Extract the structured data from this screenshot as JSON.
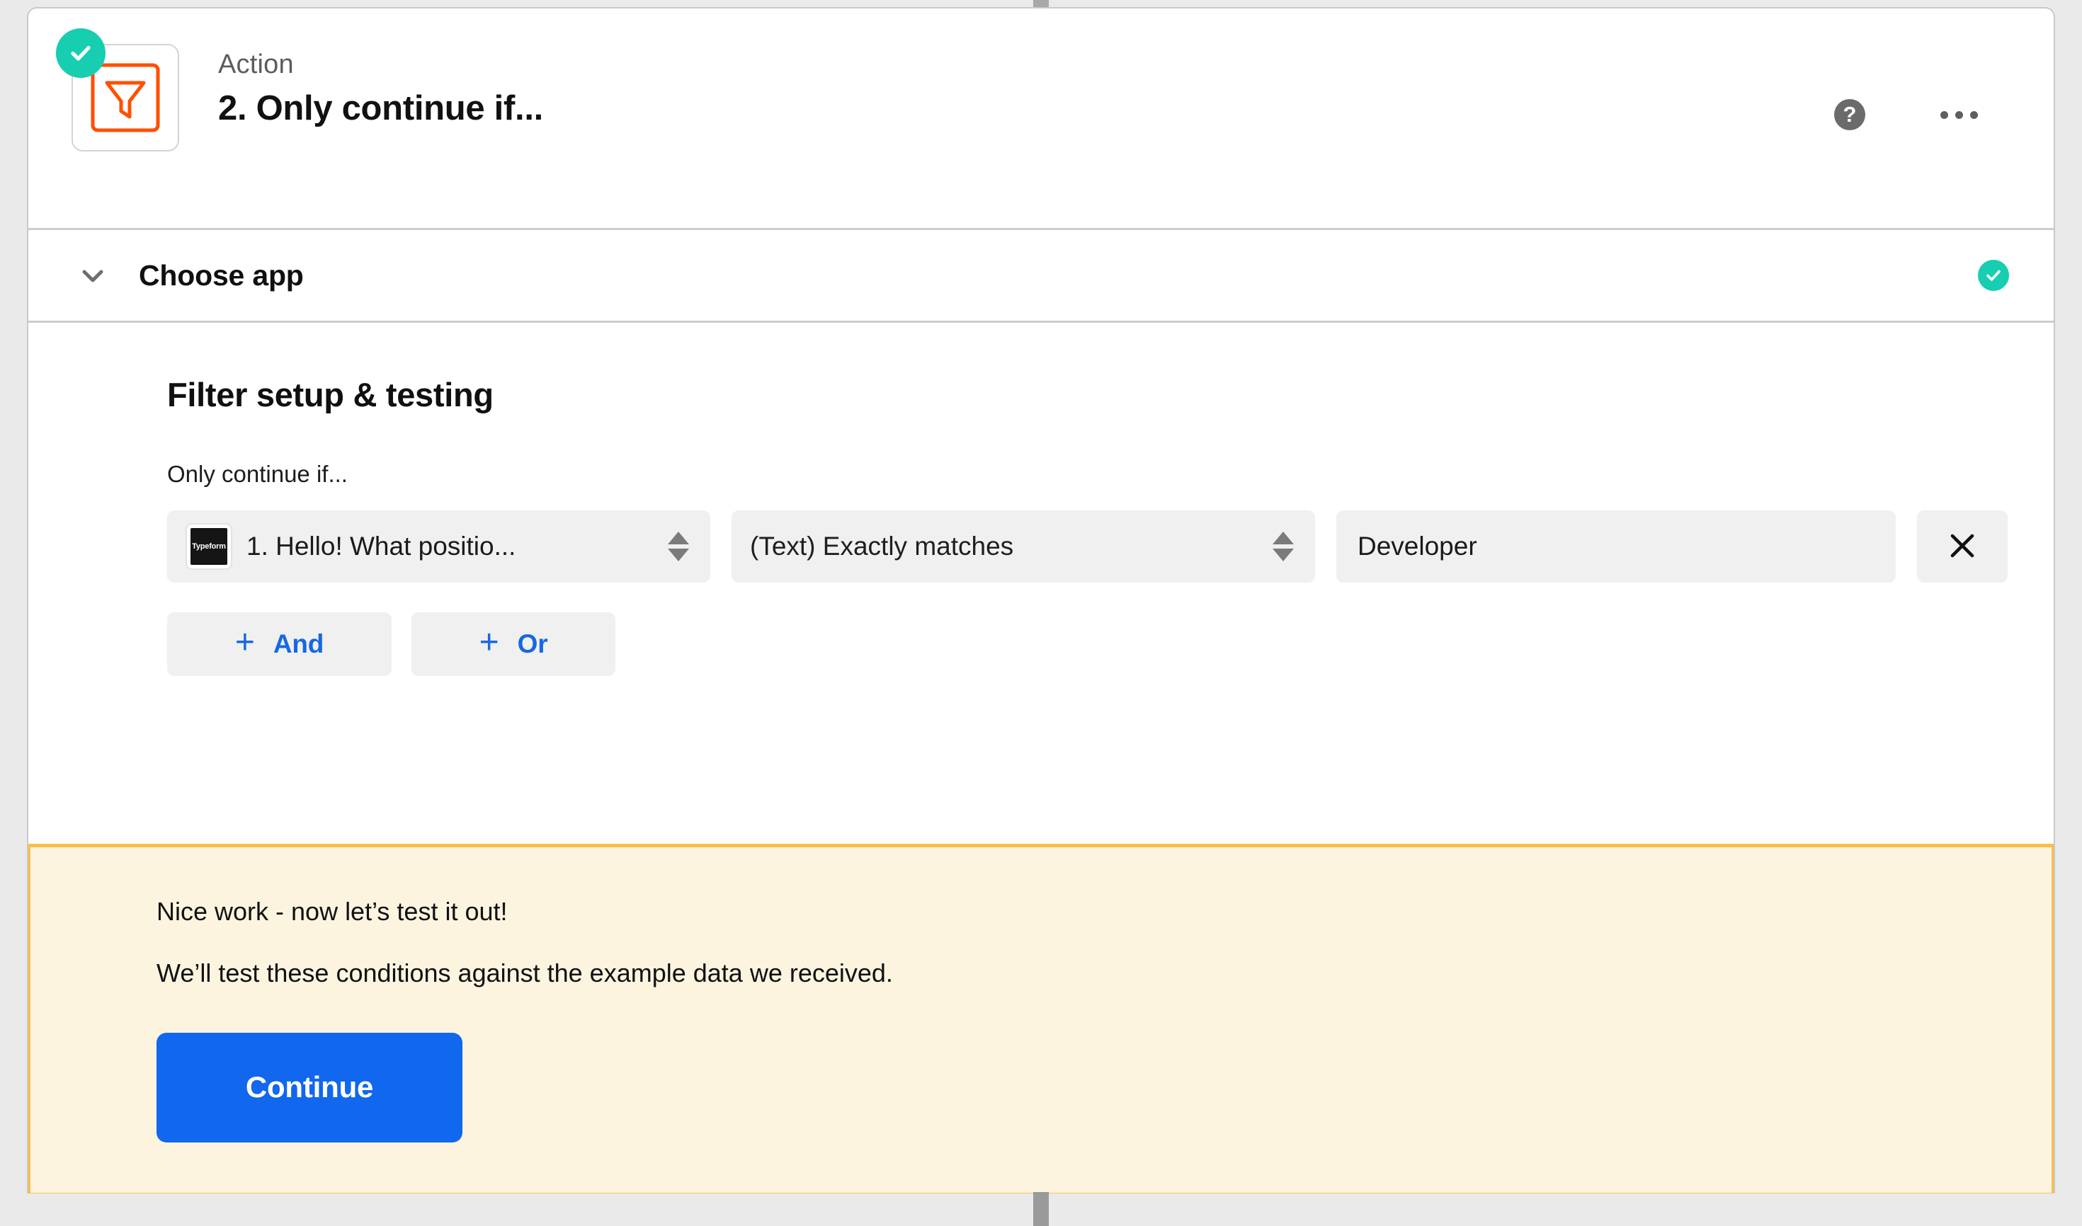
{
  "step": {
    "kicker": "Action",
    "title": "2. Only continue if...",
    "icon": "filter-funnel-icon",
    "status": "complete"
  },
  "header_actions": {
    "help_label": "?",
    "more_label": "…"
  },
  "accordion": {
    "choose_app_label": "Choose app",
    "choose_app_status": "complete"
  },
  "filter": {
    "section_title": "Filter setup & testing",
    "field_label": "Only continue if...",
    "condition": {
      "field_app": "Typeform",
      "field_value": "1. Hello! What positio...",
      "operator_value": "(Text) Exactly matches",
      "match_value": "Developer",
      "remove_label": "✕"
    },
    "add_buttons": [
      {
        "plus": "+",
        "label": "And"
      },
      {
        "plus": "+",
        "label": "Or"
      }
    ]
  },
  "banner": {
    "line1": "Nice work - now let’s test it out!",
    "line2": "We’ll test these conditions against the example data we received.",
    "continue_label": "Continue"
  },
  "colors": {
    "accent_blue": "#1167ee",
    "success_green": "#17ceb0",
    "banner_bg": "#fdf4e0",
    "banner_border": "#f9be4a",
    "app_orange": "#ff4f00",
    "page_bg": "#eaeaea"
  }
}
